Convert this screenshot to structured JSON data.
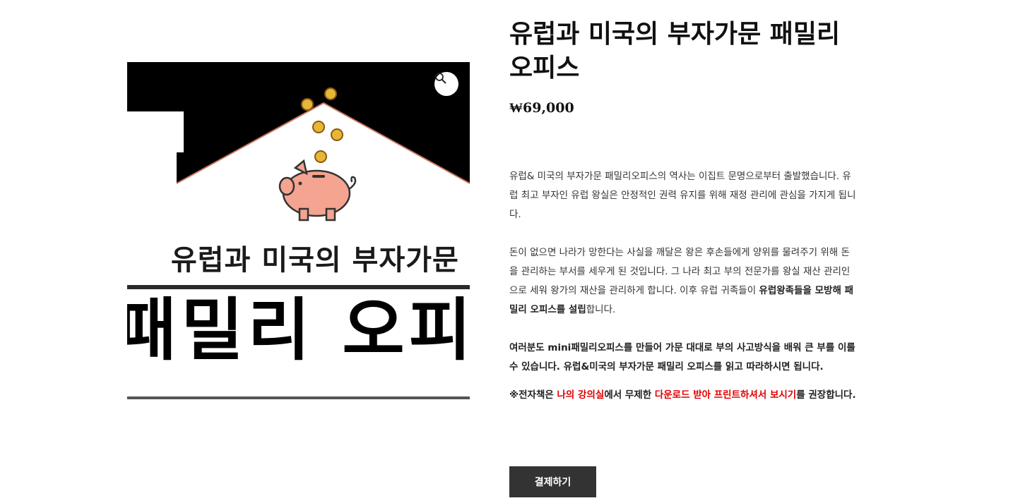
{
  "product": {
    "title": "유럽과 미국의 부자가문 패밀리오피스",
    "price": "₩69,000"
  },
  "image": {
    "line1": "유럽과 미국의 부자가문",
    "line2": "패밀리 오피",
    "zoom_icon": "magnifier-icon"
  },
  "description": {
    "p1": " 유럽& 미국의 부자가문 패밀리오피스의 역사는 이집트 문명으로부터 출발했습니다. 유럽 최고 부자인 유럽 왕실은 안정적인 권력 유지를 위해 재정 관리에 관심을 가지게 됩니다.",
    "p2_text": "돈이 없으면 나라가 망한다는 사실을 깨달은 왕은 후손들에게 양위를 물려주기 위해 돈을 관리하는 부서를 세우게 된 것입니다. 그 나라 최고 부의 전문가를 왕실 재산 관리인으로 세워 왕가의 재산을 관리하게 합니다. 이후 유럽 귀족들이 ",
    "p2_bold": "유럽왕족들을 모방해 패밀리 오피스를 설립",
    "p2_end": "합니다.",
    "p3": "여러분도 mini패밀리오피스를 만들어 가문 대대로 부의 사고방식을 배워 큰 부를 이룰 수 있습니다. 유럽&미국의 부자가문 패밀리 오피스를 읽고 따라하시면 됩니다.",
    "p4_a": "※전자책은 ",
    "p4_red1": "나의 강의실",
    "p4_b": "에서 무제한 ",
    "p4_red2": "다운로드 받아 프린트하셔서 보시기",
    "p4_c": "를 권장합니다."
  },
  "buy_button": {
    "label": "결제하기"
  },
  "colors": {
    "accent_red": "#e00000",
    "button_bg": "#333333",
    "image_black": "#000000",
    "piggy_pink": "#f4a490",
    "coin_gold": "#e8b636"
  }
}
